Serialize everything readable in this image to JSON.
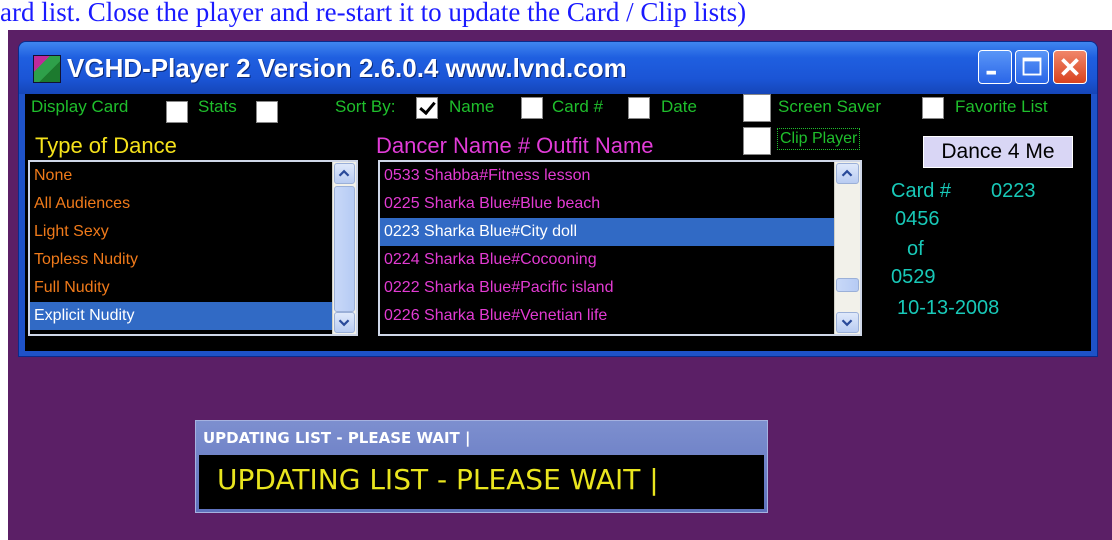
{
  "caption": "ard list. Close the player and re-start it to update the Card / Clip lists)",
  "window": {
    "title": "VGHD-Player 2  Version 2.6.0.4  www.lvnd.com",
    "minimize": "minimize",
    "maximize": "maximize",
    "close": "close"
  },
  "options": {
    "display_card": "Display Card",
    "stats": "Stats",
    "sort_by": "Sort By:",
    "name": "Name",
    "card_num": "Card #",
    "date": "Date",
    "screen_saver": "Screen Saver",
    "favorite_list": "Favorite List",
    "clip_player": "Clip Player",
    "display_card_checked": false,
    "stats_checked": false,
    "name_checked": true,
    "card_checked": false,
    "date_checked": false,
    "screen_saver_checked": false,
    "favorite_checked": false,
    "clip_player_checked": false
  },
  "type_of_dance": {
    "header": "Type of Dance",
    "items": [
      "None",
      "All Audiences",
      "Light Sexy",
      "Topless Nudity",
      "Full Nudity",
      "Explicit Nudity"
    ],
    "selected_index": 5
  },
  "dancer_list": {
    "header": "Dancer Name # Outfit Name",
    "items": [
      "0533 Shabba#Fitness lesson",
      "0225 Sharka Blue#Blue beach",
      "0223 Sharka Blue#City doll",
      "0224 Sharka Blue#Cocooning",
      "0222 Sharka Blue#Pacific island",
      "0226 Sharka Blue#Venetian life"
    ],
    "selected_index": 2
  },
  "dance_button": "Dance 4 Me",
  "info": {
    "card_label": "Card #",
    "card_value": "0223",
    "position": "0456",
    "of": "of",
    "total": "0529",
    "date": "10-13-2008"
  },
  "updating": {
    "title": "UPDATING LIST - PLEASE WAIT  |",
    "message": "UPDATING LIST - PLEASE WAIT  |"
  },
  "colors": {
    "desktop": "#5b1f66",
    "green_label": "#1fbf2c",
    "yellow_header": "#f5e21b",
    "magenta": "#e23cd8",
    "orange_item": "#f07a1a",
    "teal_info": "#18c9b8",
    "selection": "#316ac5"
  }
}
